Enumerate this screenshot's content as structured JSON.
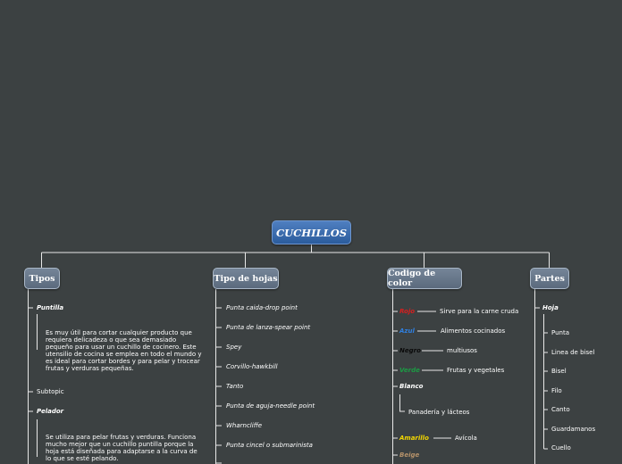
{
  "root": {
    "title": "CUCHILLOS"
  },
  "categories": {
    "tipos": "Tipos",
    "tipo_hojas": "Tipo de hojas",
    "codigo_color": "Codigo de color",
    "partes": "Partes"
  },
  "tipos": {
    "puntilla": {
      "label": "Puntilla",
      "description": "Es muy útil para cortar cualquier producto que requiera delicadeza o que sea demasiado pequeño para usar un cuchillo de cocinero. Este utensilio de cocina se emplea en todo el mundo y es ideal para cortar bordes y para pelar y trocear frutas y verduras pequeñas."
    },
    "subtopic": "Subtopic",
    "pelador": {
      "label": "Pelador",
      "description": "Se utiliza para pelar frutas y verduras. Funciona mucho mejor que un cuchillo puntilla porque la hoja está diseñada para adaptarse a la curva de lo que se esté pelando."
    }
  },
  "tipo_hojas": {
    "items": [
      "Punta caida-drop point",
      "Punta de lanza-spear point",
      "Spey",
      "Corvillo-hawkbill",
      "Tanto",
      "Punta de aguja-needle point",
      "Wharncliffe",
      "Punta cincel o submarinista"
    ]
  },
  "codigo_color": {
    "items": [
      {
        "color": "Rojo",
        "hex": "#d81e1e",
        "desc": "Sirve para la carne cruda"
      },
      {
        "color": "Azul",
        "hex": "#2f7fe0",
        "desc": "Alimentos cocinados"
      },
      {
        "color": "Negro",
        "hex": "#0a0a0a",
        "desc": "multiusos"
      },
      {
        "color": "Verde",
        "hex": "#1c9a44",
        "desc": "Frutas y vegetales"
      }
    ],
    "blanco": {
      "color": "Blanco",
      "hex": "#ffffff",
      "desc": "Panadería y lácteos"
    },
    "amarillo": {
      "color": "Amarillo",
      "hex": "#f2d600",
      "desc": "Avícola"
    },
    "beige": {
      "color": "Beige",
      "hex": "#b6926a"
    }
  },
  "partes": {
    "hoja": "Hoja",
    "items": [
      "Punta",
      "Linea de bisel",
      "Bisel",
      "Filo",
      "Canto",
      "Guardamanos",
      "Cuello"
    ]
  }
}
